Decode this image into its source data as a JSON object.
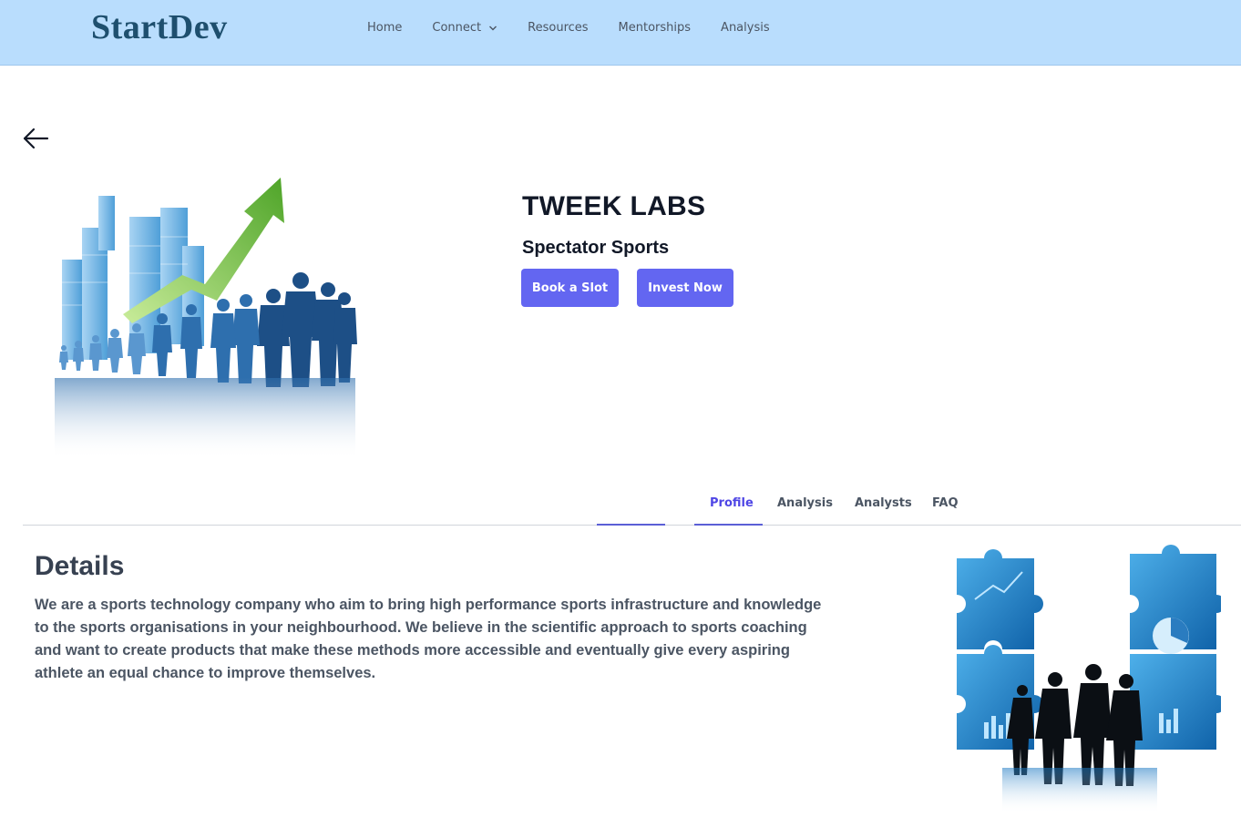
{
  "brand": "StartDev",
  "nav": {
    "items": [
      {
        "label": "Home"
      },
      {
        "label": "Connect",
        "has_dropdown": true
      },
      {
        "label": "Resources"
      },
      {
        "label": "Mentorships"
      },
      {
        "label": "Analysis"
      }
    ]
  },
  "company": {
    "name": "TWEEK LABS",
    "category": "Spectator Sports"
  },
  "actions": {
    "book_label": "Book a Slot",
    "invest_label": "Invest Now"
  },
  "tabs": [
    {
      "label": "Profile",
      "active": true
    },
    {
      "label": "Analysis"
    },
    {
      "label": "Analysts"
    },
    {
      "label": "FAQ"
    }
  ],
  "details": {
    "heading": "Details",
    "body": "We are a sports technology company who aim to bring high performance sports infrastructure and knowledge to the sports organisations in your neighbourhood. We believe in the scientific approach to sports coaching and want to create products that make these methods more accessible and eventually give every aspiring athlete an equal chance to improve themselves."
  },
  "colors": {
    "navbar_bg": "#b9ddfd",
    "brand": "#1e4f6e",
    "accent": "#6366f1"
  }
}
